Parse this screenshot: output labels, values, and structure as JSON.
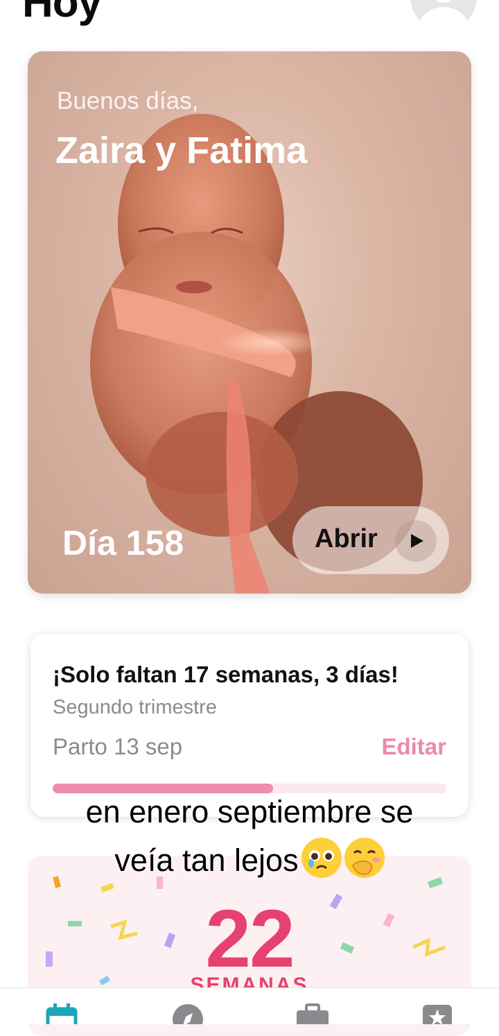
{
  "header": {
    "title": "Hoy"
  },
  "hero": {
    "greeting": "Buenos días,",
    "names": "Zaira y Fatima",
    "day": "Día 158",
    "open_label": "Abrir"
  },
  "countdown": {
    "title": "¡Solo faltan 17 semanas, 3 días!",
    "trimester": "Segundo trimestre",
    "due_date": "Parto 13 sep",
    "edit_label": "Editar",
    "progress": 0.56
  },
  "weeks": {
    "number": "22",
    "label": "SEMANAS"
  },
  "caption": {
    "line1": "en enero septiembre se",
    "line2": "veía tan lejos",
    "emojis": [
      "pleading-face-icon",
      "face-with-hand-over-mouth-icon"
    ]
  },
  "nav": {
    "items": [
      "calendar-icon",
      "compass-icon",
      "briefcase-icon",
      "star-icon"
    ],
    "active_color": "#1aa6b7"
  },
  "colors": {
    "accent_pink": "#e6416f",
    "edit_pink": "#ec8aa8",
    "progress_pink": "#f08cac"
  }
}
